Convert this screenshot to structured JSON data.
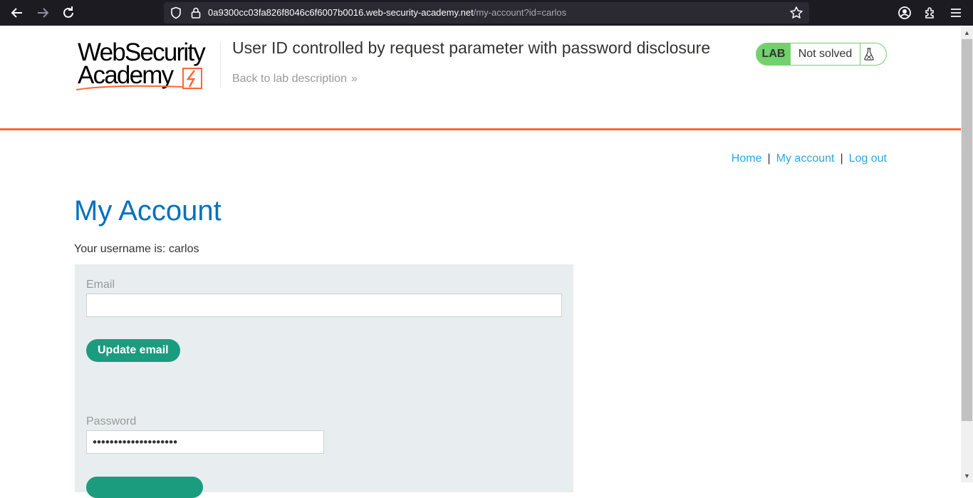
{
  "browser": {
    "url_host": "0a9300cc03fa826f8046c6f6007b0016.web-security-academy.net",
    "url_path": "/my-account?id=carlos"
  },
  "header": {
    "logo_line1": "WebSecurity",
    "logo_line2": "Academy",
    "lab_title": "User ID controlled by request parameter with password disclosure",
    "back_link": "Back to lab description",
    "badge_lab": "LAB",
    "badge_status": "Not solved"
  },
  "nav": {
    "home": "Home",
    "my_account": "My account",
    "log_out": "Log out",
    "separator": "|"
  },
  "main": {
    "title": "My Account",
    "username_line": "Your username is: carlos",
    "email_label": "Email",
    "email_value": "",
    "update_email_button": "Update email",
    "password_label": "Password",
    "password_value": "••••••••••••••••••••"
  },
  "colors": {
    "accent_orange": "#ff6633",
    "title_blue": "#0071bc",
    "link_blue": "#29a8e0",
    "button_green": "#1b9c7f",
    "lab_green": "#70d16d"
  }
}
